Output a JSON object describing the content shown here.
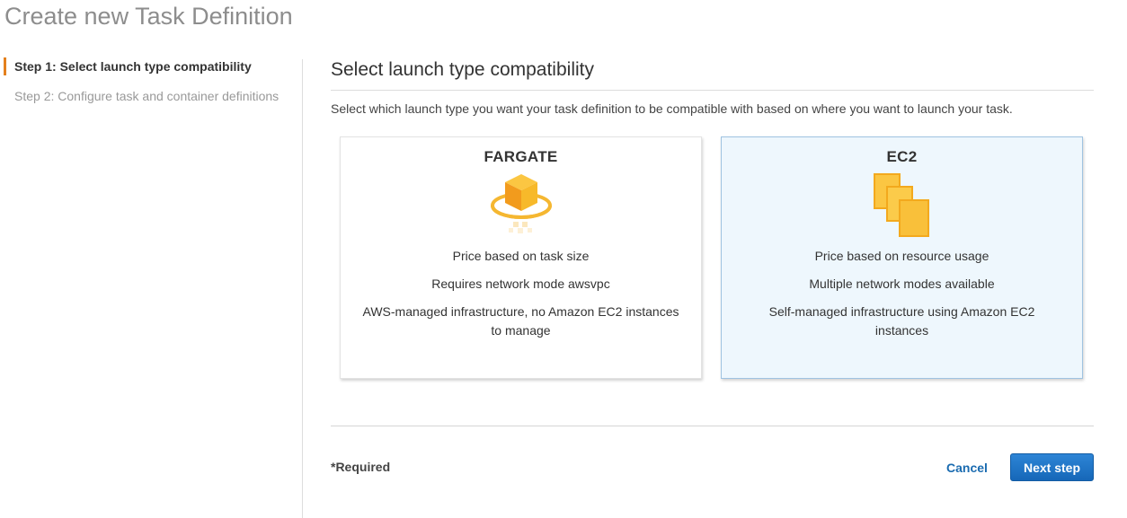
{
  "page": {
    "title": "Create new Task Definition"
  },
  "steps": [
    {
      "label": "Step 1: Select launch type compatibility",
      "active": true
    },
    {
      "label": "Step 2: Configure task and container definitions",
      "active": false
    }
  ],
  "section": {
    "title": "Select launch type compatibility",
    "description": "Select which launch type you want your task definition to be compatible with based on where you want to launch your task."
  },
  "cards": {
    "fargate": {
      "title": "FARGATE",
      "icon": "fargate-icon",
      "lines": [
        "Price based on task size",
        "Requires network mode awsvpc",
        "AWS-managed infrastructure, no Amazon EC2 instances to manage"
      ]
    },
    "ec2": {
      "title": "EC2",
      "icon": "ec2-instances-icon",
      "selected": true,
      "lines": [
        "Price based on resource usage",
        "Multiple network modes available",
        "Self-managed infrastructure using Amazon EC2 instances"
      ]
    }
  },
  "footer": {
    "required_label": "*Required",
    "cancel_label": "Cancel",
    "next_label": "Next step"
  },
  "colors": {
    "accent_orange": "#e4801e",
    "primary_blue": "#1a6bb0",
    "selected_card_bg": "#eef7fd",
    "icon_yellow": "#f7b92a"
  }
}
